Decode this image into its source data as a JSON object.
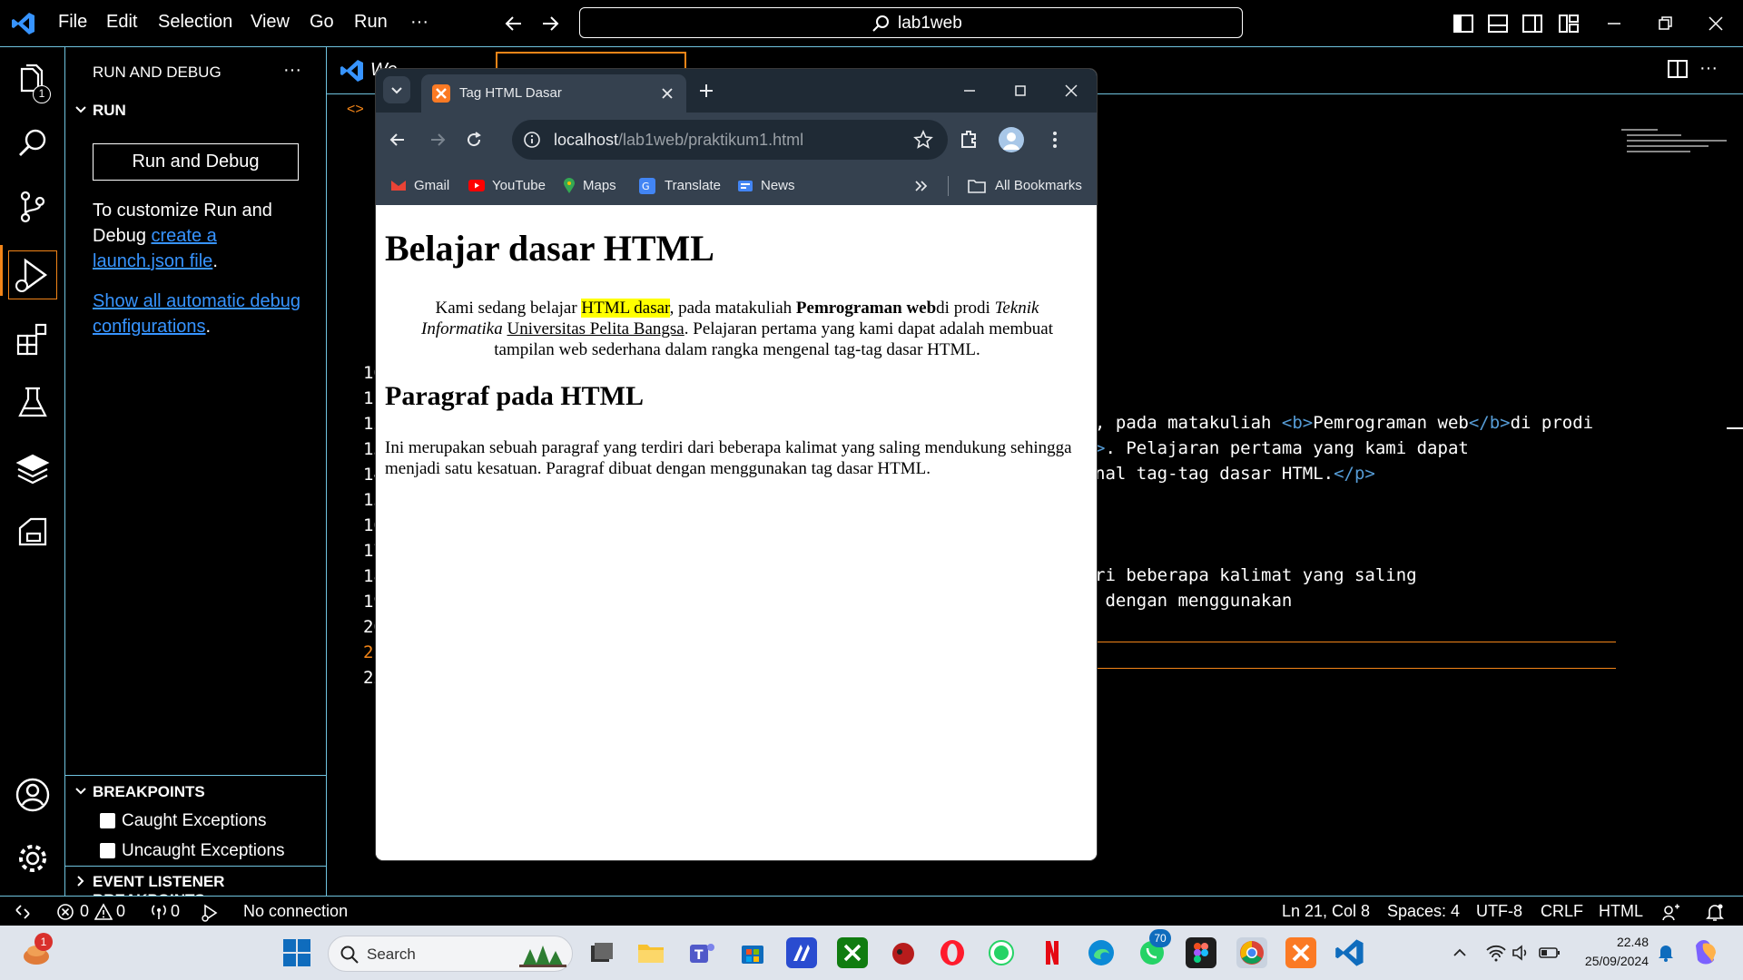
{
  "menu": {
    "file": "File",
    "edit": "Edit",
    "selection": "Selection",
    "view": "View",
    "go": "Go",
    "run": "Run",
    "more": "···"
  },
  "command_center": {
    "text": "lab1web"
  },
  "activity": {
    "explorer_badge": "1"
  },
  "sidebar": {
    "title": "RUN AND DEBUG",
    "more": "···",
    "run_section": "RUN",
    "run_debug_button": "Run and Debug",
    "customize_text_1": "To customize Run and",
    "customize_text_2": "Debug ",
    "customize_link_1": "create a",
    "customize_link_2": "launch.json file",
    "customize_dot": ".",
    "auto_link_1": "Show all automatic debug",
    "auto_link_2": "configurations",
    "auto_dot": ".",
    "breakpoints_section": "BREAKPOINTS",
    "caught": "Caught Exceptions",
    "uncaught": "Uncaught Exceptions",
    "event_section": "EVENT LISTENER BREAKPOINTS"
  },
  "editor": {
    "tab1_label": "We",
    "line_numbers": [
      "10",
      "11",
      "12",
      "13",
      "14",
      "15",
      "16",
      "17",
      "18",
      "19",
      "20",
      "21",
      "22"
    ],
    "code_line_1a": ", pada matakuliah ",
    "code_line_1b": "<b>",
    "code_line_1c": "Pemrograman web",
    "code_line_1d": "</b>",
    "code_line_1e": "di prodi",
    "code_line_2a": ">",
    "code_line_2b": ". Pelajaran pertama yang kami dapat",
    "code_line_3a": "nal tag-tag dasar HTML.",
    "code_line_3b": "</p>",
    "code_line_4": "ri beberapa kalimat yang saling",
    "code_line_5": " dengan menggunakan"
  },
  "statusbar": {
    "errors": "0",
    "warnings": "0",
    "ports": "0",
    "connection": "No connection",
    "position": "Ln 21, Col 8",
    "spaces": "Spaces: 4",
    "encoding": "UTF-8",
    "eol": "CRLF",
    "language": "HTML"
  },
  "chrome": {
    "tab_title": "Tag HTML Dasar",
    "url_host": "localhost",
    "url_path": "/lab1web/praktikum1.html",
    "bookmarks": [
      "Gmail",
      "YouTube",
      "Maps",
      "Translate",
      "News"
    ],
    "all_bookmarks": "All Bookmarks"
  },
  "page": {
    "h1": "Belajar dasar HTML",
    "p1_a": "Kami sedang belajar ",
    "p1_mark": "HTML dasar",
    "p1_b": ", pada matakuliah ",
    "p1_bold": "Pemrograman web",
    "p1_c": "di prodi ",
    "p1_italic": "Teknik Informatika",
    "p1_d": " ",
    "p1_underline": "Universitas Pelita Bangsa",
    "p1_e": ". Pelajaran pertama yang kami dapat adalah membuat tampilan web sederhana dalam rangka mengenal tag-tag dasar HTML.",
    "h2": "Paragraf pada HTML",
    "p2": "Ini merupakan sebuah paragraf yang terdiri dari beberapa kalimat yang saling mendukung sehingga menjadi satu kesatuan. Paragraf dibuat dengan menggunakan tag dasar HTML."
  },
  "taskbar": {
    "search_placeholder": "Search",
    "weather_badge": "1",
    "whatsapp_badge": "70",
    "time": "22.48",
    "date": "25/09/2024"
  }
}
